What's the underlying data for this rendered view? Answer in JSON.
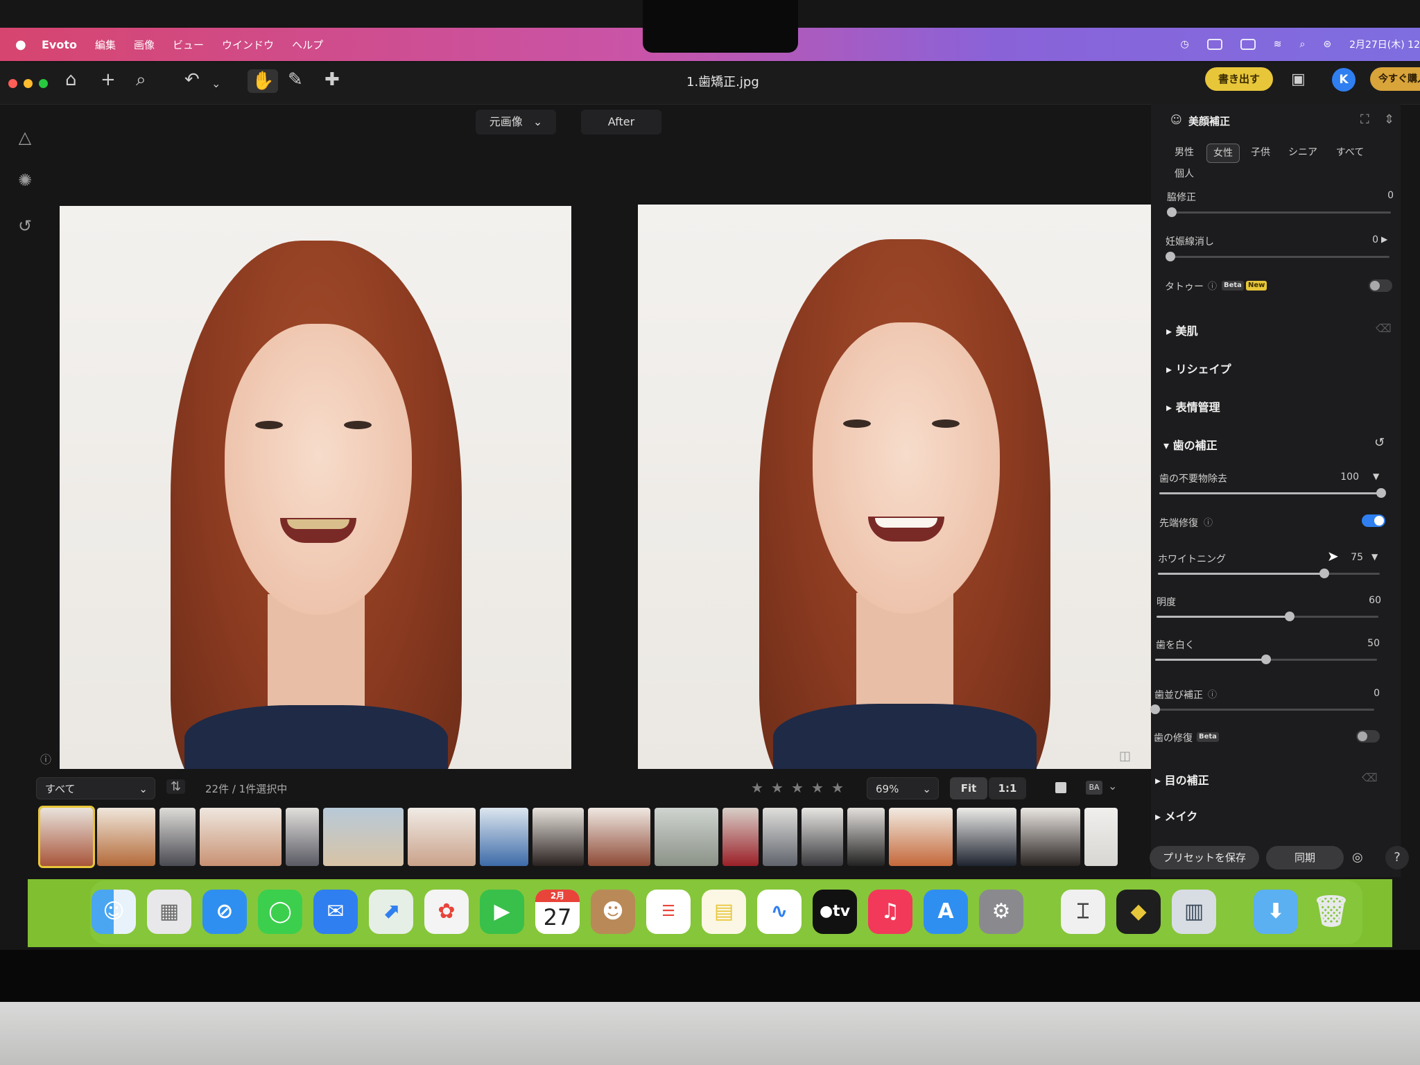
{
  "menubar": {
    "apple": "",
    "app_name": "Evoto",
    "items": [
      "編集",
      "画像",
      "ビュー",
      "ウインドウ",
      "ヘルプ"
    ],
    "clock": "2月27日(木) 12"
  },
  "toolbar": {
    "file_title": "1.歯矯正.jpg",
    "export_label": "書き出す",
    "avatar_letter": "K",
    "cta_label": "今すぐ購入"
  },
  "view": {
    "before_label": "元画像",
    "after_label": "After"
  },
  "filmstrip": {
    "filter_label": "すべて",
    "selection_text": "22件 / 1件選択中",
    "zoom_label": "69%",
    "fit_label": "Fit",
    "one_to_one_label": "1:1"
  },
  "panel": {
    "title": "美顔補正",
    "gender_tabs": [
      "男性",
      "女性",
      "子供",
      "シニア",
      "すべて",
      "個人"
    ],
    "active_tab": "女性",
    "sliders_top": [
      {
        "label": "脇修正",
        "value": "0"
      },
      {
        "label": "妊娠線消し",
        "value": "0"
      }
    ],
    "tattoo_label": "タトゥー",
    "beta_badge": "Beta",
    "new_badge": "New",
    "sections": [
      "美肌",
      "リシェイプ",
      "表情管理"
    ],
    "teeth_section": "歯の補正",
    "teeth_items": {
      "stain_label": "歯の不要物除去",
      "stain_value": "100",
      "stain_level": 1.0,
      "tip_label": "先端修復",
      "whitening_label": "ホワイトニング",
      "whitening_value": "75",
      "whitening_level": 0.75,
      "brightness_label": "明度",
      "brightness_value": "60",
      "brightness_level": 0.6,
      "whiten_label": "歯を白く",
      "whiten_value": "50",
      "whiten_level": 0.5,
      "align_label": "歯並び補正",
      "align_value": "0",
      "repair_label": "歯の修復",
      "repair_badge": "Beta"
    },
    "bottom_sections": [
      "目の補正",
      "メイク"
    ],
    "save_preset_label": "プリセットを保存",
    "sync_label": "同期",
    "help_label": "?"
  },
  "dock": {
    "calendar_month": "2月",
    "calendar_day": "27",
    "tv_label": "tv"
  }
}
